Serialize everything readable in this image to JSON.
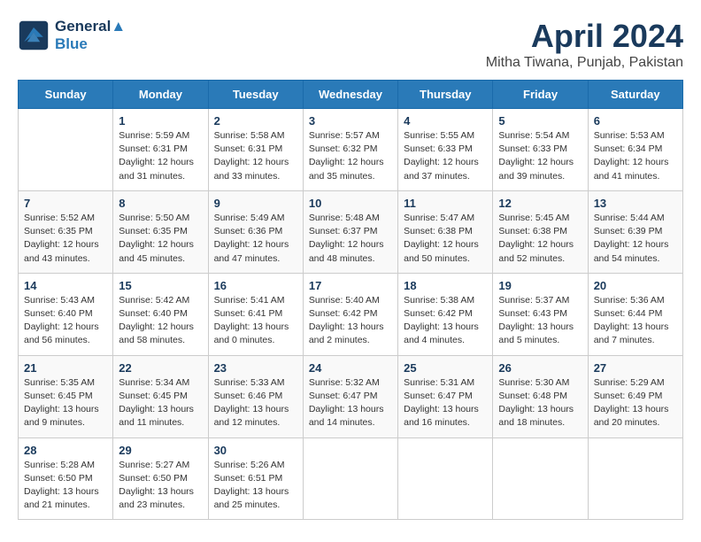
{
  "logo": {
    "line1": "General",
    "line2": "Blue"
  },
  "title": "April 2024",
  "subtitle": "Mitha Tiwana, Punjab, Pakistan",
  "header": {
    "days": [
      "Sunday",
      "Monday",
      "Tuesday",
      "Wednesday",
      "Thursday",
      "Friday",
      "Saturday"
    ]
  },
  "weeks": [
    [
      {
        "num": "",
        "info": ""
      },
      {
        "num": "1",
        "info": "Sunrise: 5:59 AM\nSunset: 6:31 PM\nDaylight: 12 hours\nand 31 minutes."
      },
      {
        "num": "2",
        "info": "Sunrise: 5:58 AM\nSunset: 6:31 PM\nDaylight: 12 hours\nand 33 minutes."
      },
      {
        "num": "3",
        "info": "Sunrise: 5:57 AM\nSunset: 6:32 PM\nDaylight: 12 hours\nand 35 minutes."
      },
      {
        "num": "4",
        "info": "Sunrise: 5:55 AM\nSunset: 6:33 PM\nDaylight: 12 hours\nand 37 minutes."
      },
      {
        "num": "5",
        "info": "Sunrise: 5:54 AM\nSunset: 6:33 PM\nDaylight: 12 hours\nand 39 minutes."
      },
      {
        "num": "6",
        "info": "Sunrise: 5:53 AM\nSunset: 6:34 PM\nDaylight: 12 hours\nand 41 minutes."
      }
    ],
    [
      {
        "num": "7",
        "info": "Sunrise: 5:52 AM\nSunset: 6:35 PM\nDaylight: 12 hours\nand 43 minutes."
      },
      {
        "num": "8",
        "info": "Sunrise: 5:50 AM\nSunset: 6:35 PM\nDaylight: 12 hours\nand 45 minutes."
      },
      {
        "num": "9",
        "info": "Sunrise: 5:49 AM\nSunset: 6:36 PM\nDaylight: 12 hours\nand 47 minutes."
      },
      {
        "num": "10",
        "info": "Sunrise: 5:48 AM\nSunset: 6:37 PM\nDaylight: 12 hours\nand 48 minutes."
      },
      {
        "num": "11",
        "info": "Sunrise: 5:47 AM\nSunset: 6:38 PM\nDaylight: 12 hours\nand 50 minutes."
      },
      {
        "num": "12",
        "info": "Sunrise: 5:45 AM\nSunset: 6:38 PM\nDaylight: 12 hours\nand 52 minutes."
      },
      {
        "num": "13",
        "info": "Sunrise: 5:44 AM\nSunset: 6:39 PM\nDaylight: 12 hours\nand 54 minutes."
      }
    ],
    [
      {
        "num": "14",
        "info": "Sunrise: 5:43 AM\nSunset: 6:40 PM\nDaylight: 12 hours\nand 56 minutes."
      },
      {
        "num": "15",
        "info": "Sunrise: 5:42 AM\nSunset: 6:40 PM\nDaylight: 12 hours\nand 58 minutes."
      },
      {
        "num": "16",
        "info": "Sunrise: 5:41 AM\nSunset: 6:41 PM\nDaylight: 13 hours\nand 0 minutes."
      },
      {
        "num": "17",
        "info": "Sunrise: 5:40 AM\nSunset: 6:42 PM\nDaylight: 13 hours\nand 2 minutes."
      },
      {
        "num": "18",
        "info": "Sunrise: 5:38 AM\nSunset: 6:42 PM\nDaylight: 13 hours\nand 4 minutes."
      },
      {
        "num": "19",
        "info": "Sunrise: 5:37 AM\nSunset: 6:43 PM\nDaylight: 13 hours\nand 5 minutes."
      },
      {
        "num": "20",
        "info": "Sunrise: 5:36 AM\nSunset: 6:44 PM\nDaylight: 13 hours\nand 7 minutes."
      }
    ],
    [
      {
        "num": "21",
        "info": "Sunrise: 5:35 AM\nSunset: 6:45 PM\nDaylight: 13 hours\nand 9 minutes."
      },
      {
        "num": "22",
        "info": "Sunrise: 5:34 AM\nSunset: 6:45 PM\nDaylight: 13 hours\nand 11 minutes."
      },
      {
        "num": "23",
        "info": "Sunrise: 5:33 AM\nSunset: 6:46 PM\nDaylight: 13 hours\nand 12 minutes."
      },
      {
        "num": "24",
        "info": "Sunrise: 5:32 AM\nSunset: 6:47 PM\nDaylight: 13 hours\nand 14 minutes."
      },
      {
        "num": "25",
        "info": "Sunrise: 5:31 AM\nSunset: 6:47 PM\nDaylight: 13 hours\nand 16 minutes."
      },
      {
        "num": "26",
        "info": "Sunrise: 5:30 AM\nSunset: 6:48 PM\nDaylight: 13 hours\nand 18 minutes."
      },
      {
        "num": "27",
        "info": "Sunrise: 5:29 AM\nSunset: 6:49 PM\nDaylight: 13 hours\nand 20 minutes."
      }
    ],
    [
      {
        "num": "28",
        "info": "Sunrise: 5:28 AM\nSunset: 6:50 PM\nDaylight: 13 hours\nand 21 minutes."
      },
      {
        "num": "29",
        "info": "Sunrise: 5:27 AM\nSunset: 6:50 PM\nDaylight: 13 hours\nand 23 minutes."
      },
      {
        "num": "30",
        "info": "Sunrise: 5:26 AM\nSunset: 6:51 PM\nDaylight: 13 hours\nand 25 minutes."
      },
      {
        "num": "",
        "info": ""
      },
      {
        "num": "",
        "info": ""
      },
      {
        "num": "",
        "info": ""
      },
      {
        "num": "",
        "info": ""
      }
    ]
  ]
}
